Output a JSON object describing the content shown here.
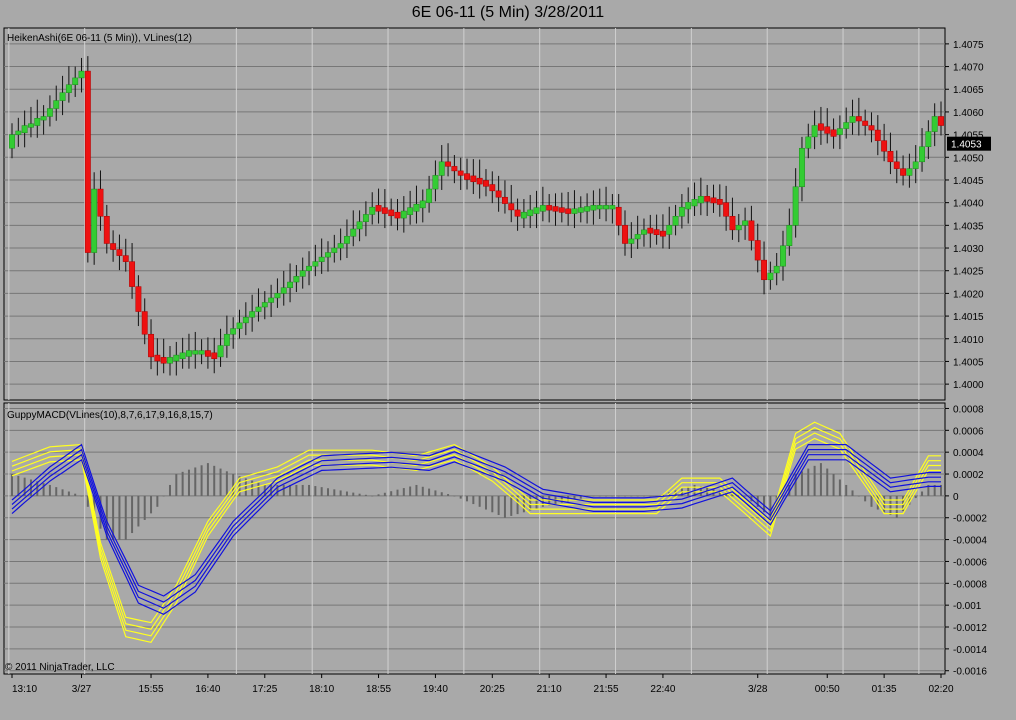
{
  "title": "6E 06-11 (5 Min)  3/28/2011",
  "copyright": "© 2011 NinjaTrader, LLC",
  "colors": {
    "background": "#a9a9a9",
    "up_candle": "#33cc33",
    "down_candle": "#ee1111",
    "macd_fast": "#ffff22",
    "macd_slow": "#1111dd",
    "histogram": "#666666",
    "grid": "#777777",
    "vline": "#d0d0d0",
    "last_price_bg": "#000000"
  },
  "chart_data": [
    {
      "type": "candlestick",
      "label": "HeikenAshi(6E 06-11 (5 Min)), VLines(12)",
      "ylim": [
        1.39965,
        1.40785
      ],
      "y_ticks": [
        "1.4000",
        "1.4005",
        "1.4010",
        "1.4015",
        "1.4020",
        "1.4025",
        "1.4030",
        "1.4035",
        "1.4040",
        "1.4045",
        "1.4050",
        "1.4055",
        "1.4060",
        "1.4065",
        "1.4070",
        "1.4075"
      ],
      "last_price": "1.4053",
      "anchors": [
        {
          "i": 0,
          "p": 1.4055
        },
        {
          "i": 5,
          "p": 1.4059
        },
        {
          "i": 9,
          "p": 1.4066
        },
        {
          "i": 11,
          "p": 1.4069
        },
        {
          "i": 12,
          "p": 1.4029
        },
        {
          "i": 13,
          "p": 1.4043
        },
        {
          "i": 15,
          "p": 1.4031
        },
        {
          "i": 18,
          "p": 1.4027
        },
        {
          "i": 20,
          "p": 1.4016
        },
        {
          "i": 22,
          "p": 1.4006
        },
        {
          "i": 24,
          "p": 1.4005
        },
        {
          "i": 26,
          "p": 1.4006
        },
        {
          "i": 28,
          "p": 1.4007
        },
        {
          "i": 30,
          "p": 1.4007
        },
        {
          "i": 32,
          "p": 1.4006
        },
        {
          "i": 34,
          "p": 1.4011
        },
        {
          "i": 38,
          "p": 1.4016
        },
        {
          "i": 42,
          "p": 1.402
        },
        {
          "i": 46,
          "p": 1.4025
        },
        {
          "i": 52,
          "p": 1.4031
        },
        {
          "i": 57,
          "p": 1.4039
        },
        {
          "i": 61,
          "p": 1.4037
        },
        {
          "i": 65,
          "p": 1.404
        },
        {
          "i": 68,
          "p": 1.4049
        },
        {
          "i": 71,
          "p": 1.4046
        },
        {
          "i": 75,
          "p": 1.4044
        },
        {
          "i": 80,
          "p": 1.4037
        },
        {
          "i": 84,
          "p": 1.4039
        },
        {
          "i": 88,
          "p": 1.4038
        },
        {
          "i": 92,
          "p": 1.4039
        },
        {
          "i": 95,
          "p": 1.4039
        },
        {
          "i": 97,
          "p": 1.4031
        },
        {
          "i": 100,
          "p": 1.4034
        },
        {
          "i": 103,
          "p": 1.4033
        },
        {
          "i": 106,
          "p": 1.4039
        },
        {
          "i": 109,
          "p": 1.4041
        },
        {
          "i": 112,
          "p": 1.404
        },
        {
          "i": 114,
          "p": 1.4034
        },
        {
          "i": 116,
          "p": 1.4036
        },
        {
          "i": 119,
          "p": 1.4023
        },
        {
          "i": 121,
          "p": 1.4026
        },
        {
          "i": 123,
          "p": 1.4035
        },
        {
          "i": 125,
          "p": 1.4052
        },
        {
          "i": 127,
          "p": 1.4057
        },
        {
          "i": 130,
          "p": 1.4055
        },
        {
          "i": 133,
          "p": 1.4059
        },
        {
          "i": 136,
          "p": 1.4056
        },
        {
          "i": 139,
          "p": 1.4049
        },
        {
          "i": 141,
          "p": 1.4046
        },
        {
          "i": 143,
          "p": 1.4049
        },
        {
          "i": 146,
          "p": 1.4059
        },
        {
          "i": 147,
          "p": 1.4057
        }
      ]
    },
    {
      "type": "line+histogram",
      "label": "GuppyMACD(VLines(10),8,7,6,17,9,16,8,15,7)",
      "ylim": [
        -0.00163,
        0.00085
      ],
      "y_ticks": [
        "0.0008",
        "0.0006",
        "0.0004",
        "0.0002",
        "0",
        "-0.0002",
        "-0.0004",
        "-0.0006",
        "-0.0008",
        "-0.001",
        "-0.0012",
        "-0.0014",
        "-0.0016"
      ],
      "fast_anchors": [
        {
          "i": 0,
          "v": 0.00025
        },
        {
          "i": 6,
          "v": 0.00038
        },
        {
          "i": 11,
          "v": 0.0004
        },
        {
          "i": 14,
          "v": -0.0005
        },
        {
          "i": 18,
          "v": -0.0012
        },
        {
          "i": 22,
          "v": -0.00125
        },
        {
          "i": 26,
          "v": -0.0009
        },
        {
          "i": 31,
          "v": -0.0003
        },
        {
          "i": 36,
          "v": 0.0001
        },
        {
          "i": 42,
          "v": 0.0002
        },
        {
          "i": 47,
          "v": 0.00035
        },
        {
          "i": 57,
          "v": 0.00035
        },
        {
          "i": 64,
          "v": 0.0003
        },
        {
          "i": 70,
          "v": 0.0004
        },
        {
          "i": 76,
          "v": 0.0002
        },
        {
          "i": 82,
          "v": -0.0001
        },
        {
          "i": 90,
          "v": -0.0001
        },
        {
          "i": 97,
          "v": -0.0001
        },
        {
          "i": 102,
          "v": -0.0001
        },
        {
          "i": 106,
          "v": 0.0001
        },
        {
          "i": 112,
          "v": 0.0001
        },
        {
          "i": 116,
          "v": -0.0001
        },
        {
          "i": 120,
          "v": -0.0003
        },
        {
          "i": 124,
          "v": 0.0005
        },
        {
          "i": 127,
          "v": 0.0006
        },
        {
          "i": 131,
          "v": 0.0005
        },
        {
          "i": 138,
          "v": -0.0001
        },
        {
          "i": 141,
          "v": -0.0001
        },
        {
          "i": 145,
          "v": 0.0003
        }
      ],
      "slow_anchors": [
        {
          "i": 0,
          "v": -0.0001
        },
        {
          "i": 6,
          "v": 0.0002
        },
        {
          "i": 11,
          "v": 0.0004
        },
        {
          "i": 15,
          "v": -0.0003
        },
        {
          "i": 20,
          "v": -0.0009
        },
        {
          "i": 24,
          "v": -0.001
        },
        {
          "i": 29,
          "v": -0.0008
        },
        {
          "i": 35,
          "v": -0.0003
        },
        {
          "i": 42,
          "v": 0.0001
        },
        {
          "i": 49,
          "v": 0.0003
        },
        {
          "i": 60,
          "v": 0.00033
        },
        {
          "i": 66,
          "v": 0.0003
        },
        {
          "i": 70,
          "v": 0.00038
        },
        {
          "i": 78,
          "v": 0.0002
        },
        {
          "i": 84,
          "v": 0
        },
        {
          "i": 92,
          "v": -8e-05
        },
        {
          "i": 100,
          "v": -8e-05
        },
        {
          "i": 106,
          "v": -5e-05
        },
        {
          "i": 114,
          "v": 0.0001
        },
        {
          "i": 120,
          "v": -0.0002
        },
        {
          "i": 126,
          "v": 0.0004
        },
        {
          "i": 132,
          "v": 0.0004
        },
        {
          "i": 139,
          "v": 0.0001
        },
        {
          "i": 145,
          "v": 0.00015
        }
      ],
      "histogram_anchors": [
        {
          "i": 0,
          "v": 0.0002
        },
        {
          "i": 6,
          "v": 0.0001
        },
        {
          "i": 11,
          "v": 0
        },
        {
          "i": 15,
          "v": -0.0004
        },
        {
          "i": 18,
          "v": -0.0004
        },
        {
          "i": 23,
          "v": -0.0001
        },
        {
          "i": 26,
          "v": 0.0002
        },
        {
          "i": 31,
          "v": 0.0003
        },
        {
          "i": 35,
          "v": 0.0002
        },
        {
          "i": 40,
          "v": 0.0001
        },
        {
          "i": 47,
          "v": 0.0001
        },
        {
          "i": 57,
          "v": 0
        },
        {
          "i": 64,
          "v": 0.0001
        },
        {
          "i": 70,
          "v": 0
        },
        {
          "i": 78,
          "v": -0.0002
        },
        {
          "i": 84,
          "v": -0.0001
        },
        {
          "i": 92,
          "v": 0
        },
        {
          "i": 102,
          "v": 0
        },
        {
          "i": 108,
          "v": 0.0001
        },
        {
          "i": 116,
          "v": 0
        },
        {
          "i": 120,
          "v": -0.0002
        },
        {
          "i": 124,
          "v": 0.0002
        },
        {
          "i": 128,
          "v": 0.0003
        },
        {
          "i": 132,
          "v": 0.0001
        },
        {
          "i": 136,
          "v": -0.0001
        },
        {
          "i": 140,
          "v": -0.0002
        },
        {
          "i": 145,
          "v": 0.0001
        }
      ]
    }
  ],
  "x_axis": {
    "bar_count": 148,
    "tick_labels": [
      {
        "i": 0,
        "label": "13:10"
      },
      {
        "i": 11,
        "label": "3/27"
      },
      {
        "i": 22,
        "label": "15:55"
      },
      {
        "i": 31,
        "label": "16:40"
      },
      {
        "i": 40,
        "label": "17:25"
      },
      {
        "i": 49,
        "label": "18:10"
      },
      {
        "i": 58,
        "label": "18:55"
      },
      {
        "i": 67,
        "label": "19:40"
      },
      {
        "i": 76,
        "label": "20:25"
      },
      {
        "i": 85,
        "label": "21:10"
      },
      {
        "i": 94,
        "label": "21:55"
      },
      {
        "i": 103,
        "label": "22:40"
      },
      {
        "i": 118,
        "label": "3/28"
      },
      {
        "i": 129,
        "label": "00:50"
      },
      {
        "i": 138,
        "label": "01:35"
      },
      {
        "i": 147,
        "label": "02:20"
      }
    ],
    "vlines": [
      0,
      12,
      36,
      48,
      60,
      72,
      84,
      96,
      108,
      120,
      132,
      144
    ]
  }
}
